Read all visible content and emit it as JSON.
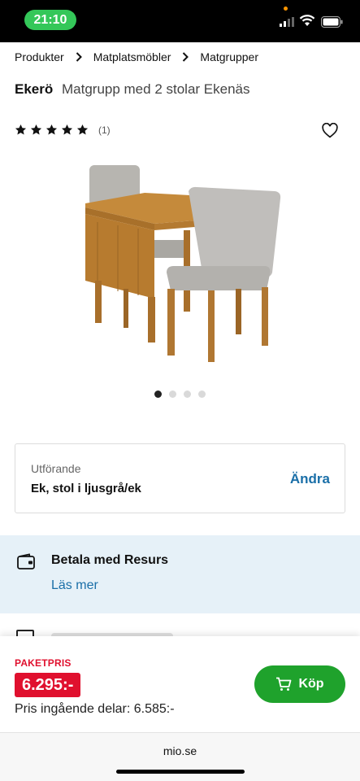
{
  "status_bar": {
    "time": "21:10"
  },
  "breadcrumb": [
    "Produkter",
    "Matplatsmöbler",
    "Matgrupper"
  ],
  "product": {
    "brand": "Ekerö",
    "name": "Matgrupp med 2 stolar Ekenäs",
    "rating": 5,
    "review_count": "(1)",
    "carousel": {
      "total": 4,
      "active": 1
    }
  },
  "variant": {
    "label": "Utförande",
    "value": "Ek, stol i ljusgrå/ek",
    "change_label": "Ändra"
  },
  "payment": {
    "title": "Betala med Resurs",
    "link": "Läs mer"
  },
  "buy": {
    "package_label": "PAKETPRIS",
    "price": "6.295:-",
    "parts_price": "Pris ingående delar: 6.585:-",
    "button_label": "Köp"
  },
  "browser": {
    "url": "mio.se"
  },
  "colors": {
    "sale_red": "#e0102e",
    "buy_green": "#1fa22c",
    "link_blue": "#1a6fa8",
    "info_bg": "#e6f1f8"
  }
}
